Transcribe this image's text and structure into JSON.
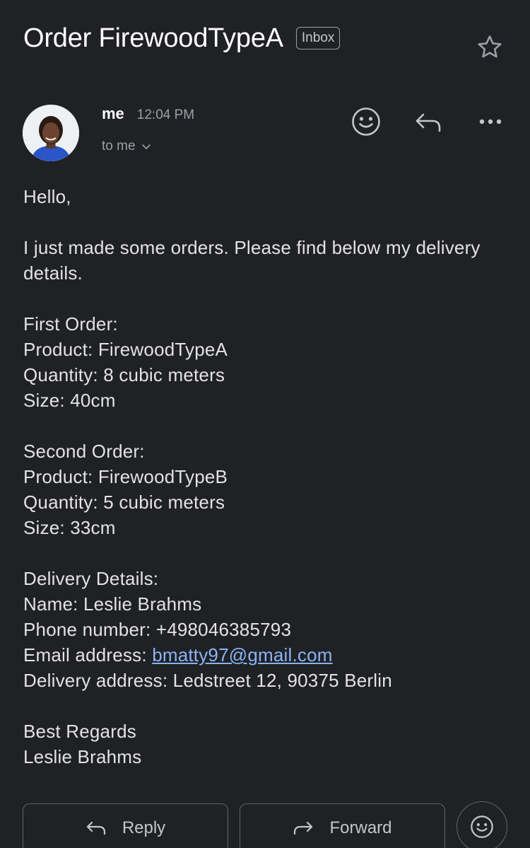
{
  "subject": {
    "title": "Order FirewoodTypeA",
    "label": "Inbox"
  },
  "header": {
    "sender": "me",
    "time": "12:04 PM",
    "recipient": "to me"
  },
  "icons": {
    "star": "star-outline-icon",
    "react": "add-emoji-icon",
    "reply": "reply-icon",
    "more": "more-horizontal-icon",
    "expand": "chevron-down-icon",
    "forward": "forward-icon"
  },
  "body": {
    "greeting": "Hello,",
    "intro": "I just made some orders. Please find below my delivery details.",
    "order1": {
      "heading": "First Order:",
      "product": "Product: FirewoodTypeA",
      "quantity": "Quantity: 8 cubic meters",
      "size": "Size: 40cm"
    },
    "order2": {
      "heading": "Second Order:",
      "product": "Product: FirewoodTypeB",
      "quantity": "Quantity: 5 cubic meters",
      "size": "Size: 33cm"
    },
    "delivery": {
      "heading": "Delivery Details:",
      "name": "Name: Leslie Brahms",
      "phone": "Phone number: +498046385793",
      "email_label": "Email address: ",
      "email": "bmatty97@gmail.com",
      "address": "Delivery address: Ledstreet 12, 90375 Berlin"
    },
    "closing": "Best Regards",
    "signature": "Leslie Brahms"
  },
  "actions": {
    "reply": "Reply",
    "forward": "Forward"
  },
  "colors": {
    "background": "#202124",
    "link": "#8ab4f8",
    "text": "#e3e3e3",
    "muted": "#9aa0a6"
  }
}
